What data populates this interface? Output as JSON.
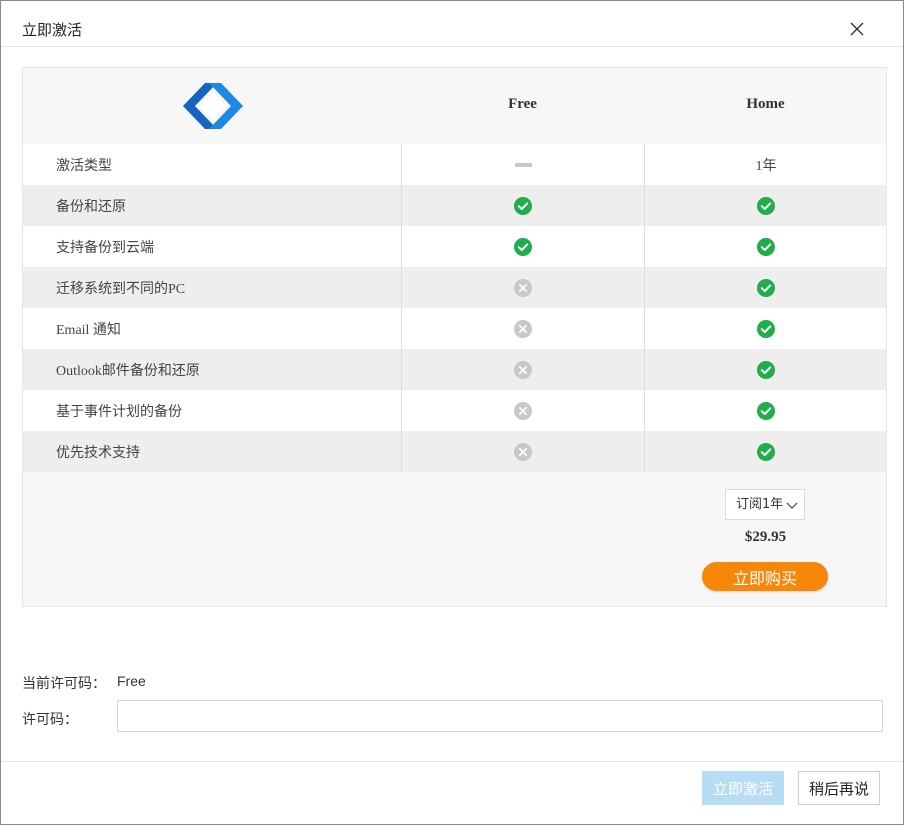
{
  "window": {
    "title": "立即激活"
  },
  "table": {
    "columns": {
      "free": "Free",
      "home": "Home"
    },
    "rows": [
      {
        "feature": "激活类型",
        "free": "dash",
        "home_text": "1年"
      },
      {
        "feature": "备份和还原",
        "free": "check",
        "home": "check"
      },
      {
        "feature": "支持备份到云端",
        "free": "check",
        "home": "check"
      },
      {
        "feature": "迁移系统到不同的PC",
        "free": "cross",
        "home": "check"
      },
      {
        "feature": "Email 通知",
        "free": "cross",
        "home": "check"
      },
      {
        "feature": "Outlook邮件备份和还原",
        "free": "cross",
        "home": "check"
      },
      {
        "feature": "基于事件计划的备份",
        "free": "cross",
        "home": "check"
      },
      {
        "feature": "优先技术支持",
        "free": "cross",
        "home": "check"
      }
    ]
  },
  "plan": {
    "selected": "订阅1年",
    "price": "$29.95",
    "buy_label": "立即购买"
  },
  "license": {
    "current_label": "当前许可码：",
    "current_value": "Free",
    "input_label": "许可码：",
    "input_value": ""
  },
  "footer": {
    "activate_label": "立即激活",
    "later_label": "稍后再说"
  },
  "colors": {
    "accent_blue": "#1565c0",
    "check_green": "#1fae4b",
    "cross_gray": "#c8c8c8",
    "buy_orange": "#f7870b",
    "activate_disabled": "#b9dcf5"
  }
}
